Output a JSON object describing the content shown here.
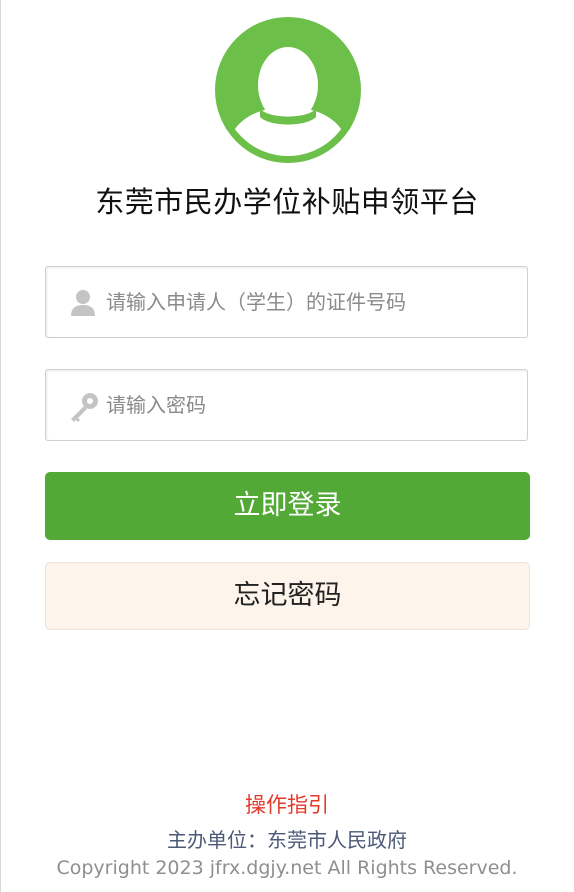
{
  "header": {
    "title": "东莞市民办学位补贴申领平台",
    "avatar_icon": "user-avatar-icon"
  },
  "login_form": {
    "id_input": {
      "icon": "user-icon",
      "placeholder": "请输入申请人（学生）的证件号码",
      "value": ""
    },
    "password_input": {
      "icon": "key-icon",
      "placeholder": "请输入密码",
      "value": ""
    },
    "login_button": "立即登录",
    "forgot_password_button": "忘记密码"
  },
  "footer": {
    "guide_link": "操作指引",
    "sponsor": "主办单位：东莞市人民政府",
    "copyright": "Copyright 2023 jfrx.dgjy.net All Rights Reserved."
  },
  "colors": {
    "brand_green": "#52a936",
    "avatar_green": "#6cc04a",
    "forgot_bg": "#fdf5eb",
    "guide_red": "#e23a2a",
    "sponsor_blue": "#4c5a78"
  }
}
